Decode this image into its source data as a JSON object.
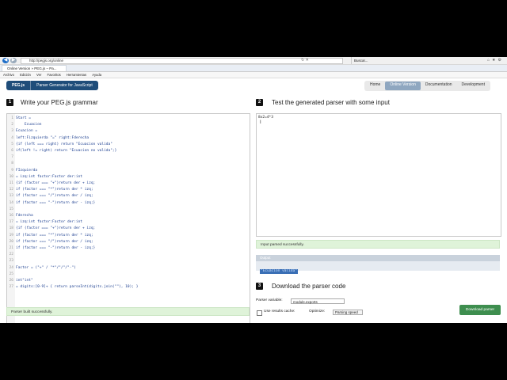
{
  "browser": {
    "url": "http://pegjs.org/online",
    "tab_title": "Online Version » PEG.js – Pa...",
    "second_tab": "Buscar...",
    "menu": [
      "Archivo",
      "Edición",
      "Ver",
      "Favoritos",
      "Herramientas",
      "Ayuda"
    ]
  },
  "header": {
    "logo": "PEG.js",
    "tagline": "Parser Generator for JavaScript",
    "nav": [
      "Home",
      "Online Version",
      "Documentation",
      "Development"
    ]
  },
  "section1": {
    "num": "1",
    "title": "Write your PEG.js grammar",
    "lines": [
      "Start =",
      "    Ecuacion",
      "Ecuacion =",
      "left:Fizquierda \"=\" right:Fderecha",
      "{if (left === right) return \"Ecuacion valida\"",
      "if(left != right) return \"Ecuacion no valida\";}",
      "",
      "",
      "FIzquierda",
      "= izq:int factor:Factor der:int",
      "{if (factor === \"+\")return der + izq;",
      "if (factor === \"*\")return der * izq;",
      "if (factor === \"/\")return der / izq;",
      "if (factor === \"-\")return der - izq;}",
      "",
      "Fderecha",
      "= izq:int factor:Factor der:int",
      "{if (factor === \"+\")return der + izq;",
      "if (factor === \"*\")return der * izq;",
      "if (factor === \"/\")return der / izq;",
      "if (factor === \"-\")return der - izq;}",
      "",
      "",
      "Factor = (\"+\" / \"*\"/\"/\"/\"-\")",
      "",
      "int\"int\"",
      "= digits:[0-9]+ { return parseInt(digits.join(\"\"), 10); }"
    ],
    "status": "Parser built successfully."
  },
  "section2": {
    "num": "2",
    "title": "Test the generated parser with some input",
    "input": "8x2=4*3",
    "status": "Input parsed successfully.",
    "output_label": "Output",
    "output_value": "\"Ecuacion valida\""
  },
  "section3": {
    "num": "3",
    "title": "Download the parser code",
    "parser_variable_label": "Parser variable:",
    "parser_variable_value": "module.exports",
    "results_cache_label": "Use results cache:",
    "optimize_label": "Optimize:",
    "optimize_value": "Parsing speed",
    "download_label": "Download parser"
  }
}
